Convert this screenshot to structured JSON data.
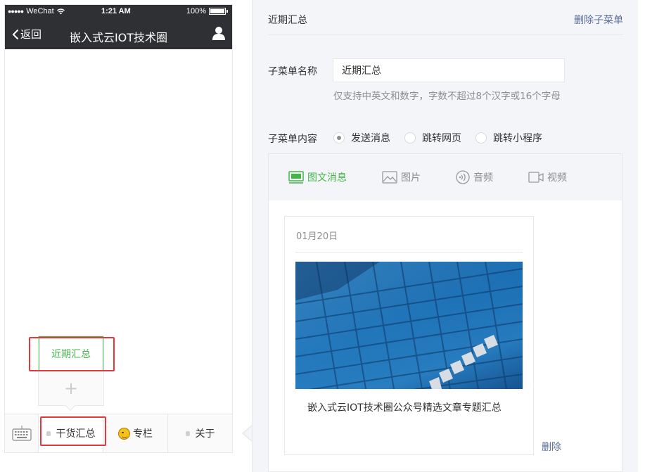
{
  "phone": {
    "status": {
      "signal_dots": "●●●●●",
      "carrier": "WeChat",
      "time": "1:21 AM",
      "battery": "100%"
    },
    "nav": {
      "back_label": "返回",
      "title": "嵌入式云IOT技术圈"
    },
    "submenu": {
      "items": [
        "近期汇总"
      ],
      "add_label": "+"
    },
    "menu": {
      "items": [
        "干货汇总",
        "专栏",
        "关于"
      ]
    }
  },
  "editor": {
    "header": {
      "title": "近期汇总",
      "delete_label": "删除子菜单"
    },
    "name_field": {
      "label": "子菜单名称",
      "value": "近期汇总",
      "hint": "仅支持中英文和数字，字数不超过8个汉字或16个字母"
    },
    "content_field": {
      "label": "子菜单内容",
      "options": [
        "发送消息",
        "跳转网页",
        "跳转小程序"
      ],
      "selected": "发送消息"
    },
    "tabs": [
      "图文消息",
      "图片",
      "音频",
      "视频"
    ],
    "article": {
      "date": "01月20日",
      "title": "嵌入式云IOT技术圈公众号精选文章专题汇总"
    },
    "remove_label": "删除"
  },
  "colors": {
    "accent_green": "#44b549",
    "link_blue": "#576b95",
    "highlight_red": "#e4393c",
    "nav_dark": "#2f3033"
  }
}
